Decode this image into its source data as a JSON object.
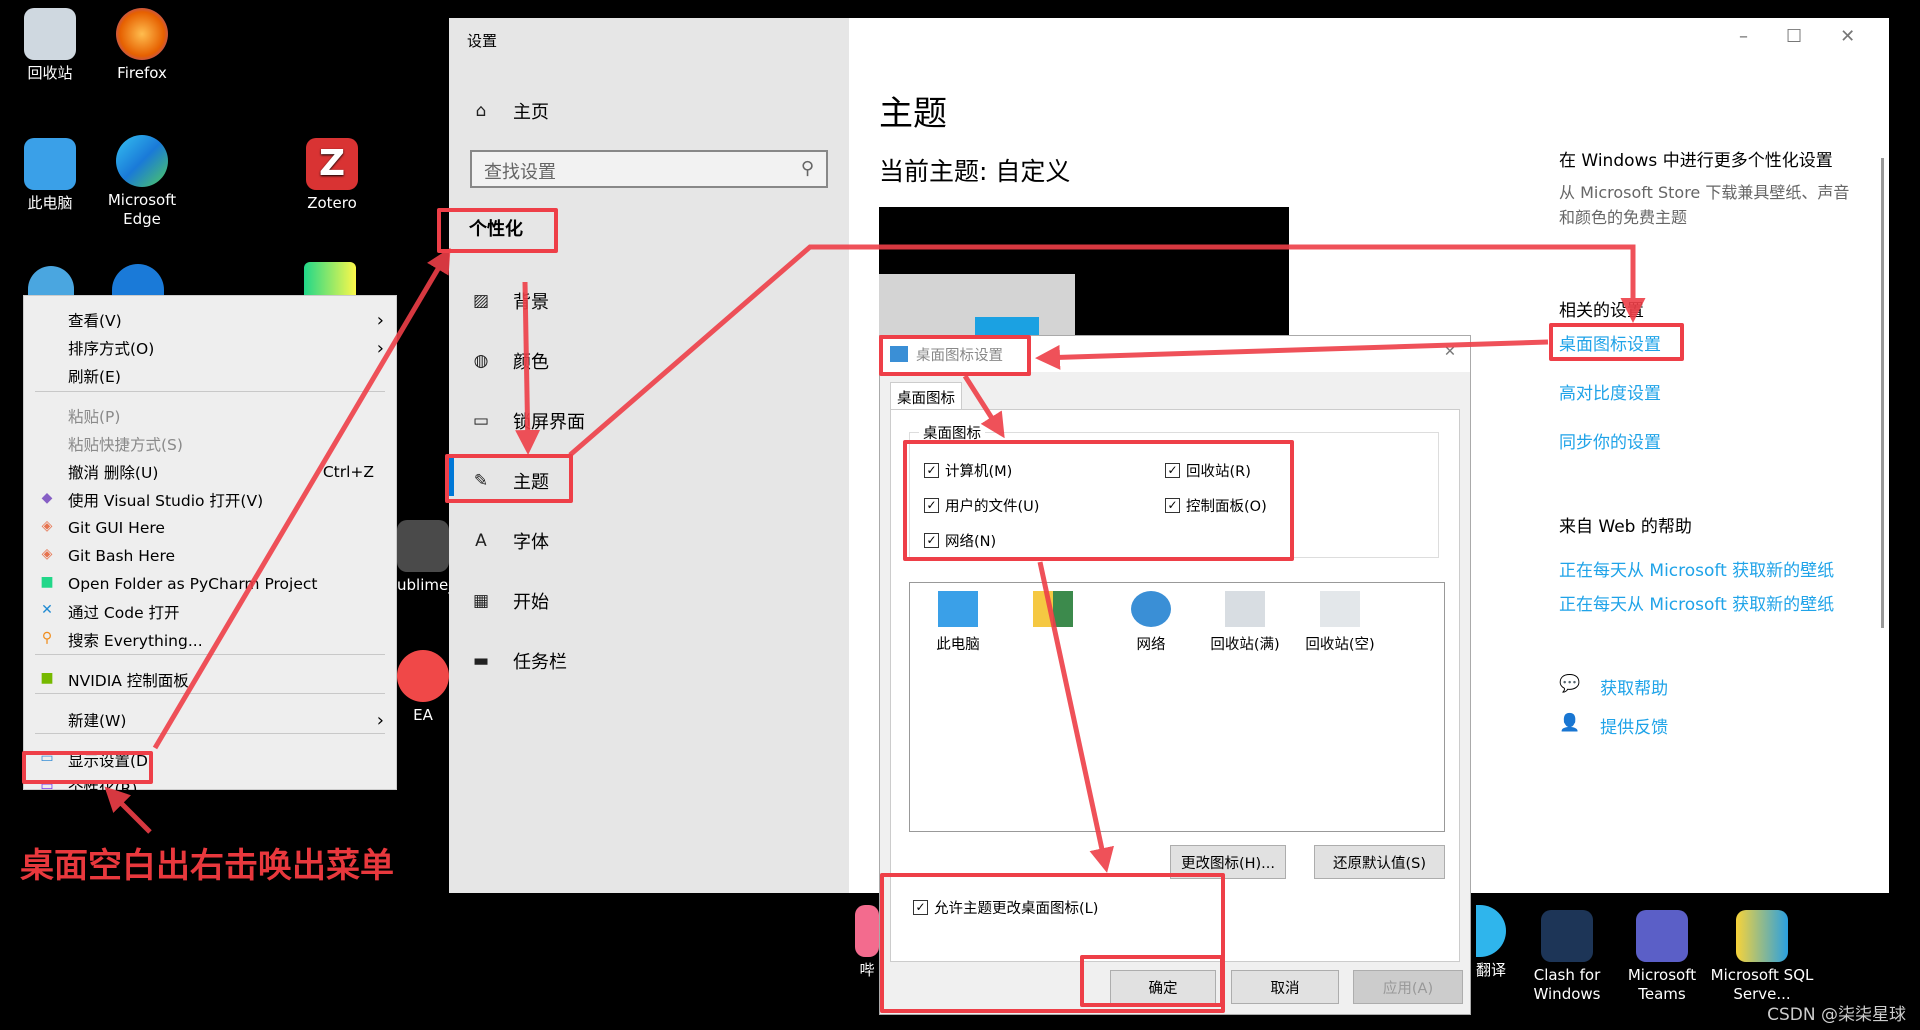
{
  "desktop": {
    "icons": [
      {
        "label": "回收站"
      },
      {
        "label": "Firefox"
      },
      {
        "label": "此电脑"
      },
      {
        "label": "Microsoft Edge"
      },
      {
        "label": "Zotero"
      },
      {
        "label": "ublime_"
      },
      {
        "label": "EA"
      },
      {
        "label": "哔"
      },
      {
        "label": "翻译"
      },
      {
        "label": "Clash for Windows"
      },
      {
        "label": "Microsoft Teams"
      },
      {
        "label": "Microsoft SQL Serve..."
      }
    ],
    "annotation": "桌面空白出右击唤出菜单",
    "watermark": "CSDN @柒柒星球"
  },
  "context_menu": {
    "items": [
      {
        "label": "查看(V)",
        "submenu": true
      },
      {
        "label": "排序方式(O)",
        "submenu": true
      },
      {
        "label": "刷新(E)"
      },
      {
        "label": "粘贴(P)",
        "disabled": true
      },
      {
        "label": "粘贴快捷方式(S)",
        "disabled": true
      },
      {
        "label": "撤消 删除(U)",
        "shortcut": "Ctrl+Z"
      },
      {
        "label": "使用 Visual Studio 打开(V)",
        "icon": "visual-studio-icon"
      },
      {
        "label": "Git GUI Here",
        "icon": "git-icon"
      },
      {
        "label": "Git Bash Here",
        "icon": "git-icon"
      },
      {
        "label": "Open Folder as PyCharm Project",
        "icon": "pycharm-icon"
      },
      {
        "label": "通过 Code 打开",
        "icon": "vscode-icon"
      },
      {
        "label": "搜索 Everything...",
        "icon": "everything-search-icon"
      },
      {
        "label": "NVIDIA 控制面板",
        "icon": "nvidia-icon"
      },
      {
        "label": "新建(W)",
        "submenu": true
      },
      {
        "label": "显示设置(D)",
        "icon": "display-icon"
      },
      {
        "label": "个性化(R)",
        "icon": "personalize-icon"
      }
    ]
  },
  "settings": {
    "window_title": "设置",
    "home": "主页",
    "search_placeholder": "查找设置",
    "section": "个性化",
    "nav": [
      {
        "label": "背景",
        "icon": "picture-icon"
      },
      {
        "label": "颜色",
        "icon": "palette-icon"
      },
      {
        "label": "锁屏界面",
        "icon": "lock-screen-icon"
      },
      {
        "label": "主题",
        "icon": "theme-icon",
        "selected": true
      },
      {
        "label": "字体",
        "icon": "font-icon"
      },
      {
        "label": "开始",
        "icon": "start-icon"
      },
      {
        "label": "任务栏",
        "icon": "taskbar-icon"
      }
    ],
    "page_title": "主题",
    "current_theme": "当前主题: 自定义",
    "right": {
      "more_title": "在 Windows 中进行更多个性化设置",
      "more_desc": "从 Microsoft Store 下载兼具壁纸、声音和颜色的免费主题",
      "related_title": "相关的设置",
      "related_links": [
        "桌面图标设置",
        "高对比度设置",
        "同步你的设置"
      ],
      "web_title": "来自 Web 的帮助",
      "web_links": [
        "正在每天从 Microsoft 获取新的壁纸",
        "正在每天从 Microsoft 获取新的壁纸"
      ],
      "get_help": "获取帮助",
      "feedback": "提供反馈"
    },
    "accent": "#0078d7"
  },
  "dialog": {
    "title": "桌面图标设置",
    "tab": "桌面图标",
    "group": "桌面图标",
    "checkboxes": [
      {
        "label": "计算机(M)",
        "checked": true
      },
      {
        "label": "回收站(R)",
        "checked": true
      },
      {
        "label": "用户的文件(U)",
        "checked": true
      },
      {
        "label": "控制面板(O)",
        "checked": true
      },
      {
        "label": "网络(N)",
        "checked": true
      }
    ],
    "icons": [
      "此电脑",
      "",
      "网络",
      "回收站(满)",
      "回收站(空)"
    ],
    "change_icon": "更改图标(H)...",
    "restore_default": "还原默认值(S)",
    "allow_theme": "允许主题更改桌面图标(L)",
    "allow_theme_checked": true,
    "ok": "确定",
    "cancel": "取消",
    "apply": "应用(A)"
  },
  "annotation_color": "#ee3f48"
}
